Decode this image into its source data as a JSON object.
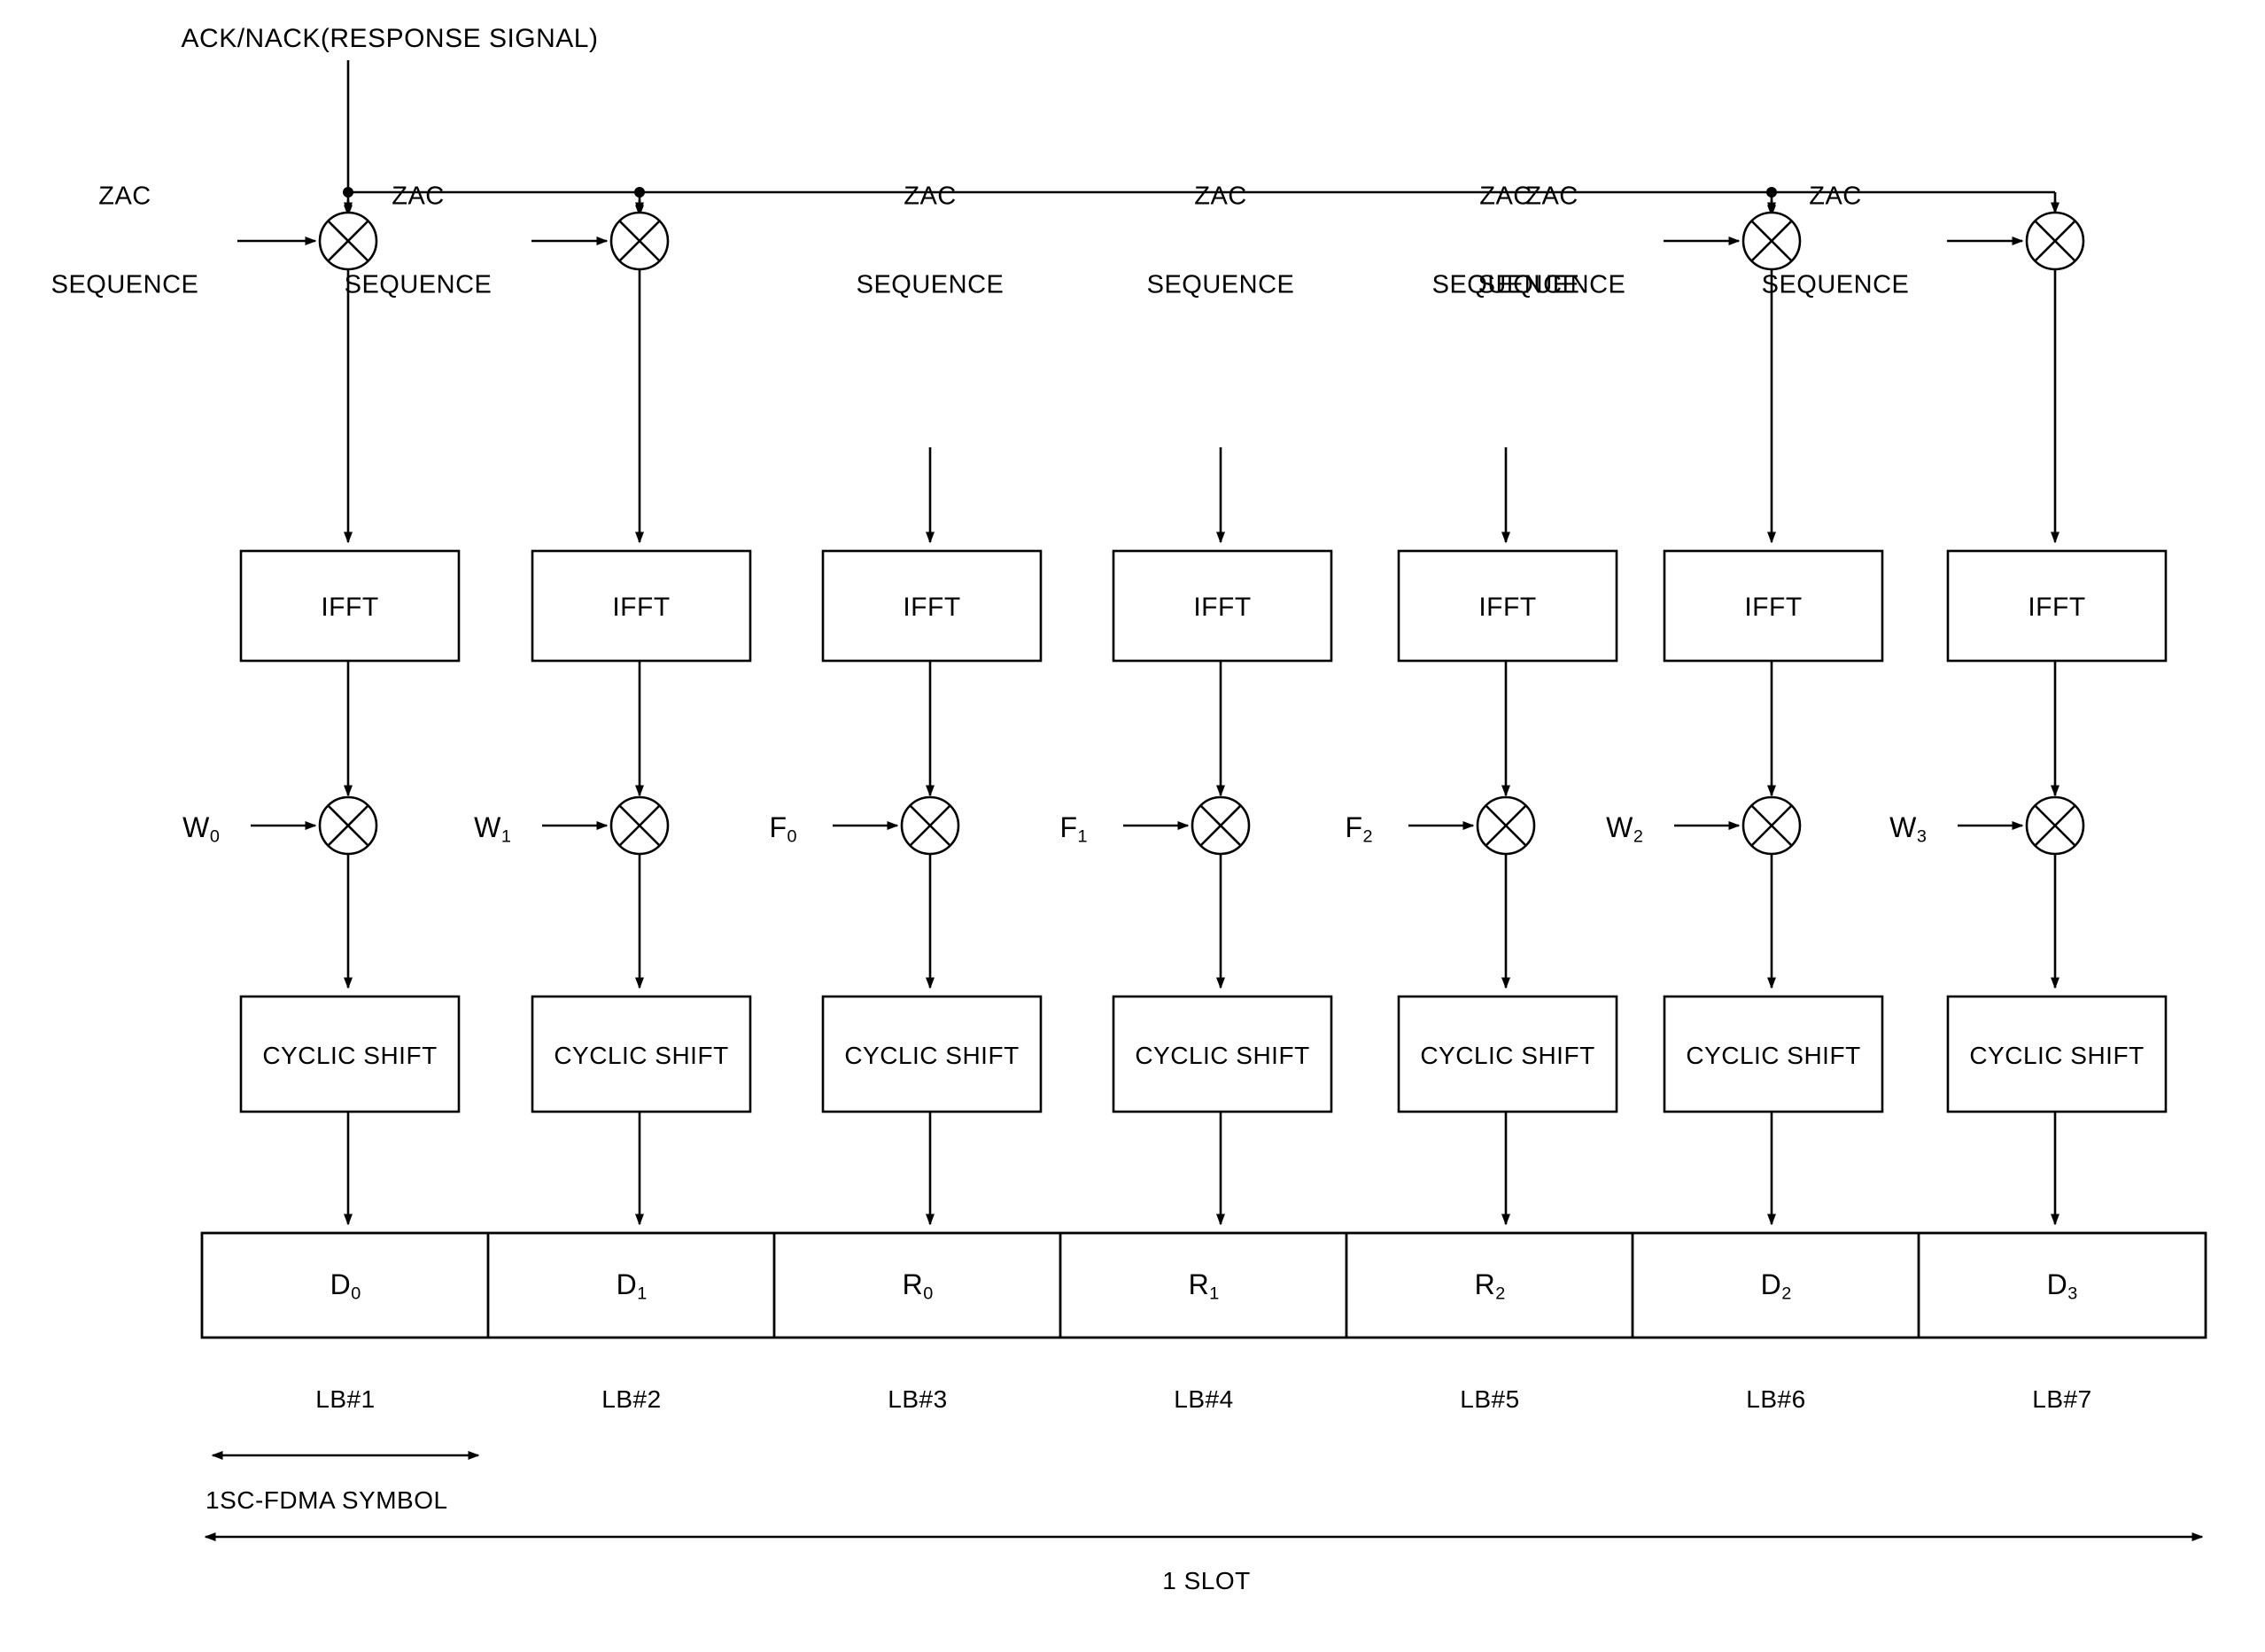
{
  "diagram": {
    "title": "ACK/NACK(RESPONSE SIGNAL)",
    "zac_label": "ZAC\nSEQUENCE",
    "ifft_label": "IFFT",
    "cyclic_shift_label": "CYCLIC SHIFT",
    "symbol_annotation": "1SC-FDMA SYMBOL",
    "slot_annotation": "1 SLOT",
    "line_color": "#000000",
    "background_color": "#ffffff"
  },
  "columns": [
    {
      "zac": "ZAC\nSEQUENCE",
      "ifft": "IFFT",
      "weight": "W",
      "weight_sub": "0",
      "cyclic": "CYCLIC SHIFT",
      "cell": "D",
      "cell_sub": "0",
      "lb": "LB#1"
    },
    {
      "zac": "ZAC\nSEQUENCE",
      "ifft": "IFFT",
      "weight": "W",
      "weight_sub": "1",
      "cyclic": "CYCLIC SHIFT",
      "cell": "D",
      "cell_sub": "1",
      "lb": "LB#2"
    },
    {
      "zac": "ZAC\nSEQUENCE",
      "ifft": "IFFT",
      "weight": "F",
      "weight_sub": "0",
      "cyclic": "CYCLIC SHIFT",
      "cell": "R",
      "cell_sub": "0",
      "lb": "LB#3"
    },
    {
      "zac": "ZAC\nSEQUENCE",
      "ifft": "IFFT",
      "weight": "F",
      "weight_sub": "1",
      "cyclic": "CYCLIC SHIFT",
      "cell": "R",
      "cell_sub": "1",
      "lb": "LB#4"
    },
    {
      "zac": "ZAC\nSEQUENCE",
      "ifft": "IFFT",
      "weight": "F",
      "weight_sub": "2",
      "cyclic": "CYCLIC SHIFT",
      "cell": "R",
      "cell_sub": "2",
      "lb": "LB#5"
    },
    {
      "zac": "ZAC\nSEQUENCE",
      "ifft": "IFFT",
      "weight": "W",
      "weight_sub": "2",
      "cyclic": "CYCLIC SHIFT",
      "cell": "D",
      "cell_sub": "2",
      "lb": "LB#6"
    },
    {
      "zac": "ZAC\nSEQUENCE",
      "ifft": "IFFT",
      "weight": "W",
      "weight_sub": "3",
      "cyclic": "CYCLIC SHIFT",
      "cell": "D",
      "cell_sub": "3",
      "lb": "LB#7"
    }
  ],
  "labels": {
    "zac_line1": "ZAC",
    "zac_line2": "SEQUENCE",
    "lb1": "LB#1",
    "lb2": "LB#2",
    "lb3": "LB#3",
    "lb4": "LB#4",
    "lb5": "LB#5",
    "lb6": "LB#6",
    "lb7": "LB#7"
  }
}
